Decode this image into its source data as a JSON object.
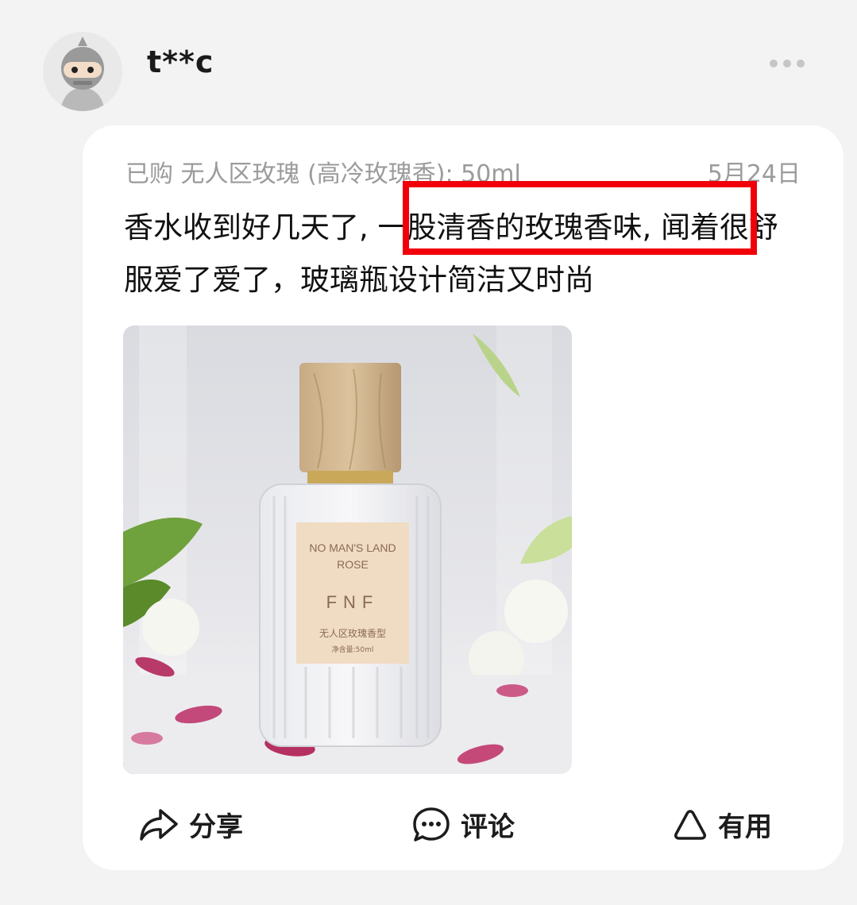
{
  "user": {
    "name": "t**c"
  },
  "review": {
    "meta": "已购 无人区玫瑰 (高冷玫瑰香); 50ml",
    "date": "5月24日",
    "text_before": "香水收到好几天了, ",
    "text_highlight": "一股清香的玫瑰香味, ",
    "text_after": "闻着很舒服爱了爱了，玻璃瓶设计简洁又时尚"
  },
  "product_image": {
    "label_line1": "NO MAN'S LAND",
    "label_line2": "ROSE",
    "brand": "FNF",
    "cn_name": "无人区玫瑰香型",
    "volume": "净含量:50ml"
  },
  "actions": {
    "share": "分享",
    "comment": "评论",
    "useful": "有用"
  },
  "colors": {
    "highlight_border": "#f2000a",
    "meta_text": "#9b9b9b"
  },
  "icons": [
    "more-icon",
    "share-icon",
    "comment-icon",
    "useful-icon"
  ]
}
